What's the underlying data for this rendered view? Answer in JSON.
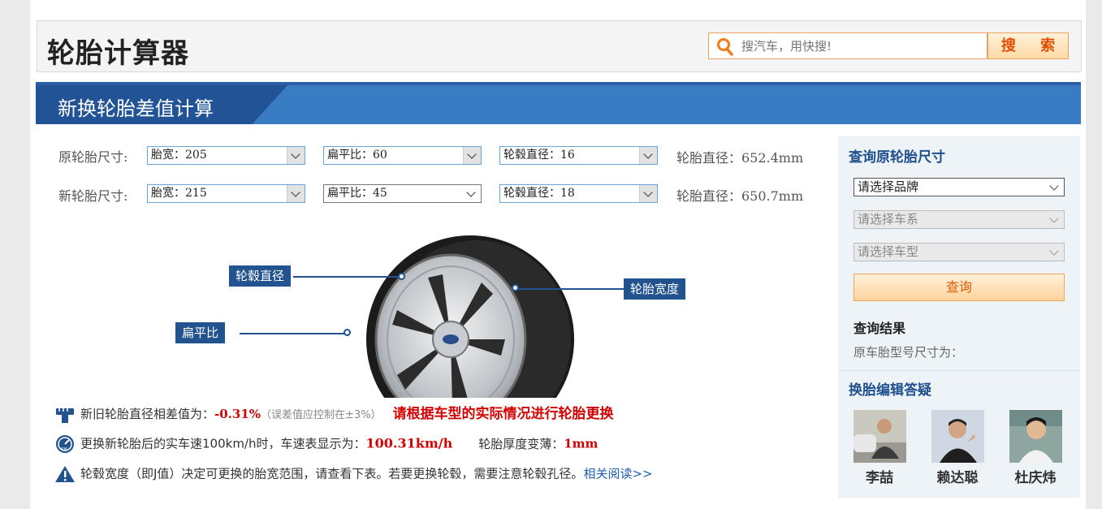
{
  "header": {
    "title": "轮胎计算器",
    "search_placeholder": "搜汽车，用快搜!",
    "search_button": "搜 索"
  },
  "section": {
    "title": "新换轮胎差值计算"
  },
  "original_tire": {
    "label": "原轮胎尺寸:",
    "width": "胎宽：205",
    "aspect": "扁平比：60",
    "rim": "轮毂直径：16",
    "diameter": "轮胎直径：652.4mm"
  },
  "new_tire": {
    "label": "新轮胎尺寸:",
    "width": "胎宽：215",
    "aspect": "扁平比：45",
    "rim": "轮毂直径：18",
    "diameter": "轮胎直径：650.7mm"
  },
  "diagram": {
    "rim_label": "轮毂直径",
    "aspect_label": "扁平比",
    "width_label": "轮胎宽度"
  },
  "results": {
    "diff_prefix": "新旧轮胎直径相差值为：",
    "diff_value": "-0.31%",
    "diff_note": "（误差值应控制在±3%）",
    "diff_warning": "请根据车型的实际情况进行轮胎更换",
    "speed_prefix": "更换新轮胎后的实车速100km/h时，车速表显示为：",
    "speed_value": "100.31km/h",
    "thin_prefix": "轮胎厚度变薄：",
    "thin_value": "1mm",
    "width_note": "轮毂宽度（即J值）决定可更换的胎宽范围，请查看下表。若要更换轮毂，需要注意轮毂孔径。",
    "read_more": "相关阅读>>"
  },
  "sidebar": {
    "title": "查询原轮胎尺寸",
    "brand": "请选择品牌",
    "series": "请选择车系",
    "model": "请选择车型",
    "query_button": "查询",
    "result_title": "查询结果",
    "result_text": "原车胎型号尺寸为：",
    "editors_title": "换胎编辑答疑",
    "editors": [
      "李喆",
      "赖达聪",
      "杜庆炜"
    ]
  },
  "colors": {
    "accent_blue": "#3a7cc4",
    "dark_blue": "#225396",
    "warning_red": "#d40000",
    "button_orange": "#ffd39c"
  }
}
